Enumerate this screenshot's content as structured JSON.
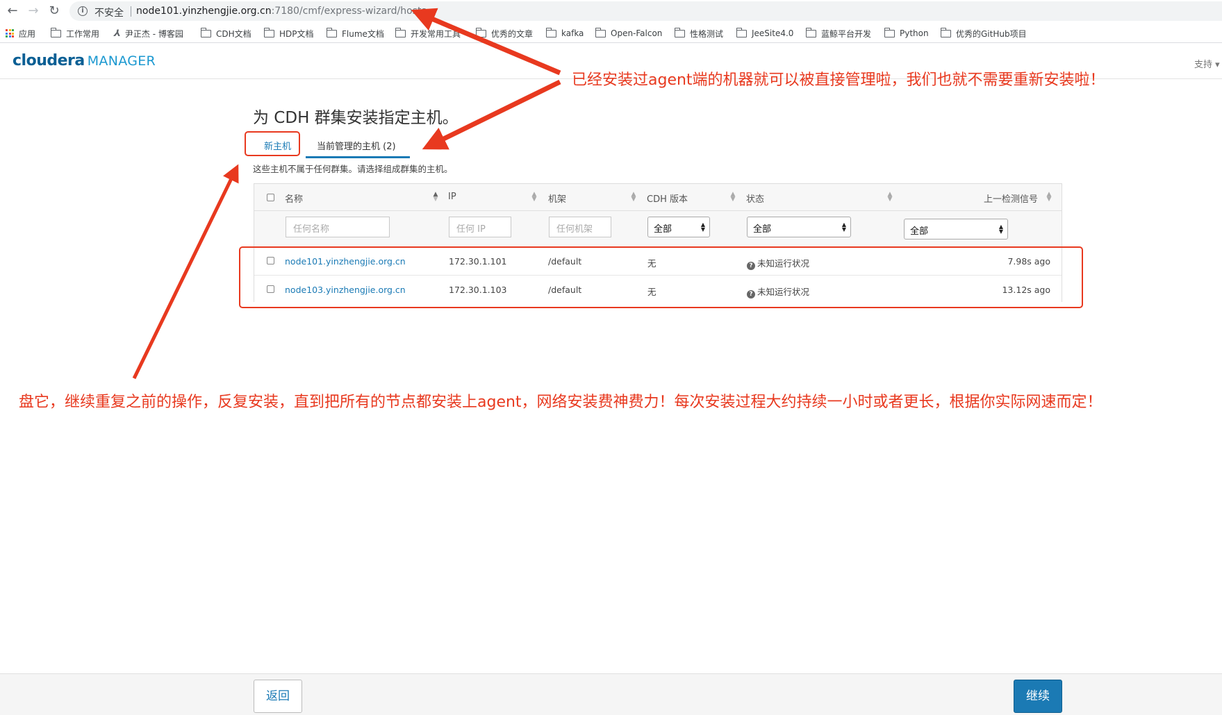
{
  "browser": {
    "security_label": "不安全",
    "url_host": "node101.yinzhengjie.org.cn",
    "url_path": ":7180/cmf/express-wizard/hosts",
    "nav_icons": [
      "back-arrow-icon",
      "forward-arrow-icon",
      "reload-icon",
      "info-icon"
    ],
    "bookmarks": [
      {
        "label": "应用",
        "icon": "apps-grid-icon"
      },
      {
        "label": "工作常用",
        "icon": "folder-icon"
      },
      {
        "label": "尹正杰 - 博客园",
        "icon": "blog-icon"
      },
      {
        "label": "CDH文档",
        "icon": "folder-icon"
      },
      {
        "label": "HDP文档",
        "icon": "folder-icon"
      },
      {
        "label": "Flume文档",
        "icon": "folder-icon"
      },
      {
        "label": "开发常用工具",
        "icon": "folder-icon"
      },
      {
        "label": "优秀的文章",
        "icon": "folder-icon"
      },
      {
        "label": "kafka",
        "icon": "folder-icon"
      },
      {
        "label": "Open-Falcon",
        "icon": "folder-icon"
      },
      {
        "label": "性格测试",
        "icon": "folder-icon"
      },
      {
        "label": "JeeSite4.0",
        "icon": "folder-icon"
      },
      {
        "label": "蓝鲸平台开发",
        "icon": "folder-icon"
      },
      {
        "label": "Python",
        "icon": "folder-icon"
      },
      {
        "label": "优秀的GitHub项目",
        "icon": "folder-icon"
      }
    ]
  },
  "header": {
    "logo_cloudera": "cloudera",
    "logo_manager": "MANAGER",
    "support_label": "支持 ▾",
    "brand_color": "#0a5f94"
  },
  "main": {
    "title": "为 CDH 群集安装指定主机。",
    "tabs": [
      {
        "label": "新主机",
        "active": false
      },
      {
        "label": "当前管理的主机 (2)",
        "active": true
      }
    ],
    "subtitle": "这些主机不属于任何群集。请选择组成群集的主机。",
    "table": {
      "columns": [
        "名称",
        "IP",
        "机架",
        "CDH 版本",
        "状态",
        "上一检测信号"
      ],
      "filters": {
        "name_placeholder": "任何名称",
        "ip_placeholder": "任何 IP",
        "rack_placeholder": "任何机架",
        "cdh_version_selected": "全部",
        "status_selected": "全部",
        "heartbeat_selected": "全部"
      },
      "rows": [
        {
          "name": "node101.yinzhengjie.org.cn",
          "ip": "172.30.1.101",
          "rack": "/default",
          "cdh_version": "无",
          "status": "未知运行状况",
          "heartbeat": "7.98s ago"
        },
        {
          "name": "node103.yinzhengjie.org.cn",
          "ip": "172.30.1.103",
          "rack": "/default",
          "cdh_version": "无",
          "status": "未知运行状况",
          "heartbeat": "13.12s ago"
        }
      ]
    }
  },
  "annotations": {
    "note_top": "已经安装过agent端的机器就可以被直接管理啦，我们也就不需要重新安装啦！",
    "note_bottom": "盘它，继续重复之前的操作，反复安装，直到把所有的节点都安装上agent，网络安装费神费力！每次安装过程大约持续一小时或者更长，根据你实际网速而定！",
    "color": "#e8391f"
  },
  "footer": {
    "back_label": "返回",
    "continue_label": "继续",
    "accent_color": "#1b7ab4"
  }
}
